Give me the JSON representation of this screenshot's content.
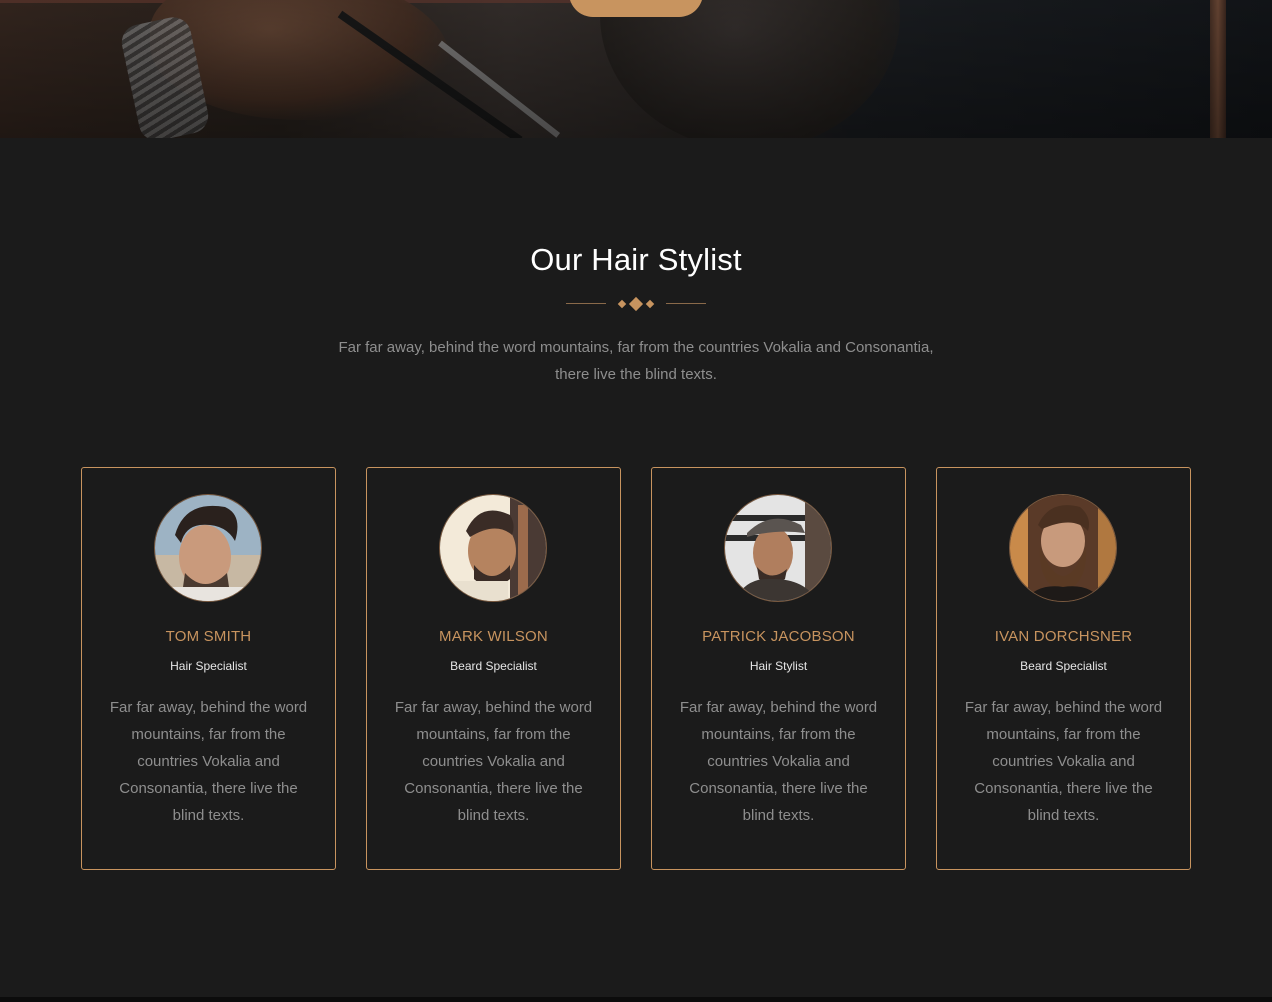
{
  "hero": {
    "button_label": ""
  },
  "section": {
    "title": "Our Hair Stylist",
    "intro": "Far far away, behind the word mountains, far from the countries Vokalia and Consonantia, there live the blind texts."
  },
  "stylists": [
    {
      "name": "TOM SMITH",
      "role": "Hair Specialist",
      "bio": "Far far away, behind the word mountains, far from the countries Vokalia and Consonantia, there live the blind texts."
    },
    {
      "name": "MARK WILSON",
      "role": "Beard Specialist",
      "bio": "Far far away, behind the word mountains, far from the countries Vokalia and Consonantia, there live the blind texts."
    },
    {
      "name": "PATRICK JACOBSON",
      "role": "Hair Stylist",
      "bio": "Far far away, behind the word mountains, far from the countries Vokalia and Consonantia, there live the blind texts."
    },
    {
      "name": "IVAN DORCHSNER",
      "role": "Beard Specialist",
      "bio": "Far far away, behind the word mountains, far from the countries Vokalia and Consonantia, there live the blind texts."
    }
  ],
  "colors": {
    "accent": "#c8945f",
    "background": "#1b1b1b",
    "heading": "#ffffff",
    "body_text": "#8e8e8e"
  }
}
